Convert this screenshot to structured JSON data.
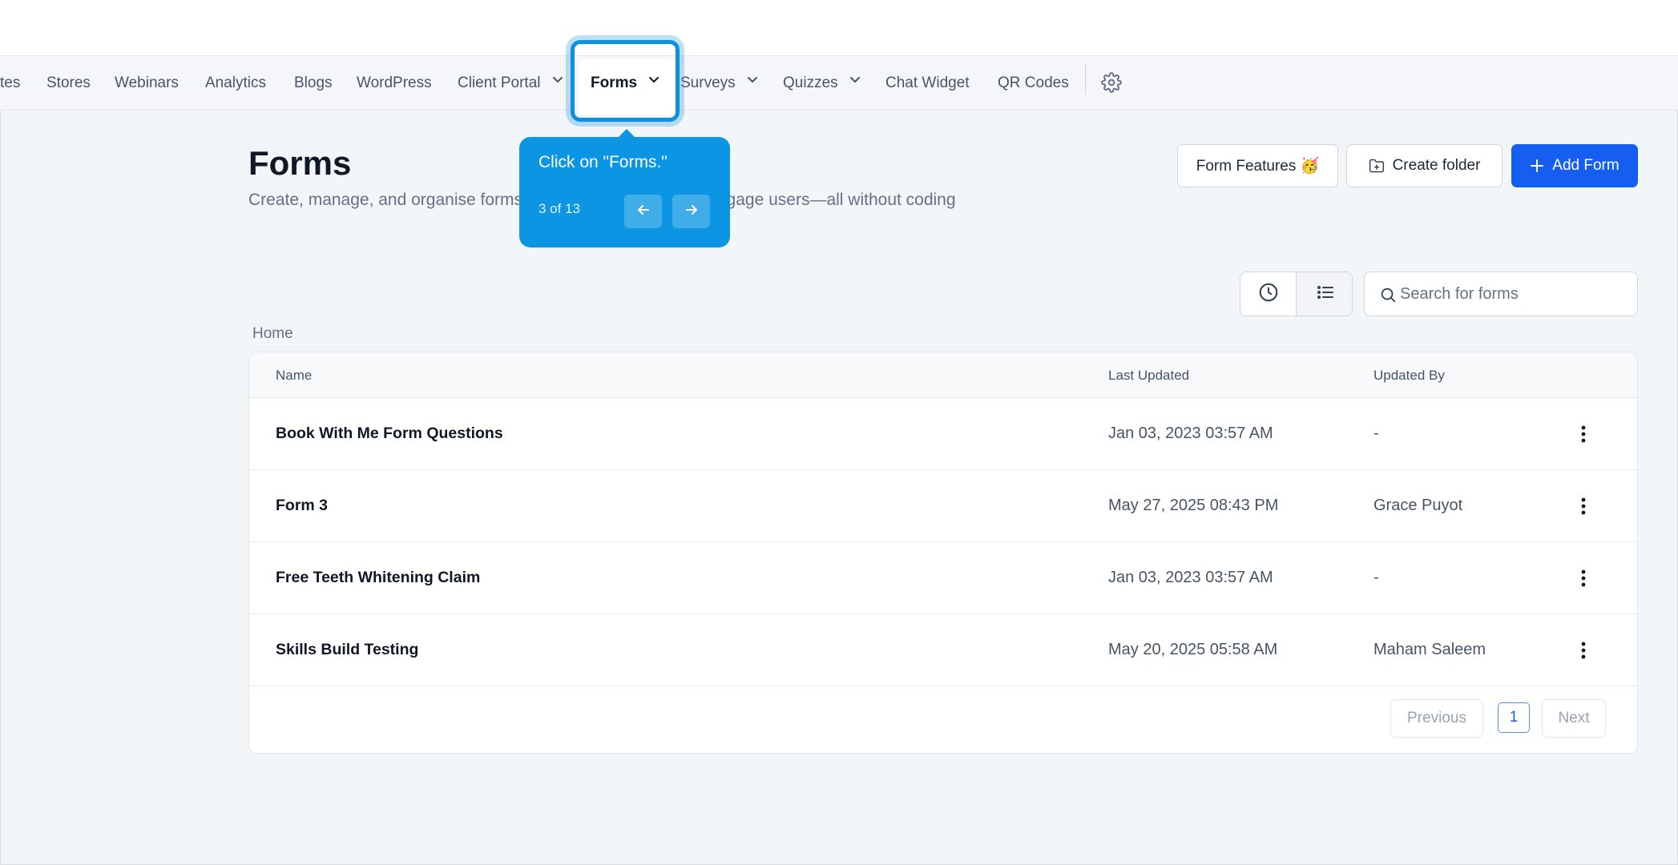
{
  "nav": {
    "items": [
      {
        "label": "tes",
        "dropdown": false
      },
      {
        "label": "Stores",
        "dropdown": false
      },
      {
        "label": "Webinars",
        "dropdown": false
      },
      {
        "label": "Analytics",
        "dropdown": false
      },
      {
        "label": "Blogs",
        "dropdown": false
      },
      {
        "label": "WordPress",
        "dropdown": false
      },
      {
        "label": "Client Portal",
        "dropdown": true
      },
      {
        "label": "Forms",
        "dropdown": true,
        "active": true
      },
      {
        "label": "Surveys",
        "dropdown": true
      },
      {
        "label": "Quizzes",
        "dropdown": true
      },
      {
        "label": "Chat Widget",
        "dropdown": false
      },
      {
        "label": "QR Codes",
        "dropdown": false
      }
    ],
    "settings_icon": "gear-icon"
  },
  "tour": {
    "text": "Click on \"Forms.\"",
    "step": "3 of 13",
    "prev_icon": "arrow-left-icon",
    "next_icon": "arrow-right-icon"
  },
  "header": {
    "title": "Forms",
    "description": "Create, manage, and organise forms to capture lead info and engage users—all without coding",
    "form_features_label": "Form Features 🥳",
    "create_folder_label": "Create folder",
    "add_form_label": "Add Form"
  },
  "view_toggle": {
    "options": [
      "clock-icon",
      "list-icon"
    ],
    "selected": "list-icon"
  },
  "search": {
    "placeholder": "Search for forms",
    "value": ""
  },
  "breadcrumb": "Home",
  "table": {
    "columns": [
      "Name",
      "Last Updated",
      "Updated By"
    ],
    "rows": [
      {
        "name": "Book With Me Form Questions",
        "last_updated": "Jan 03, 2023 03:57 AM",
        "updated_by": "-"
      },
      {
        "name": "Form 3",
        "last_updated": "May 27, 2025 08:43 PM",
        "updated_by": "Grace Puyot"
      },
      {
        "name": "Free Teeth Whitening Claim",
        "last_updated": "Jan 03, 2023 03:57 AM",
        "updated_by": "-"
      },
      {
        "name": "Skills Build Testing",
        "last_updated": "May 20, 2025 05:58 AM",
        "updated_by": "Maham Saleem"
      }
    ]
  },
  "pagination": {
    "previous_label": "Previous",
    "current_page": "1",
    "next_label": "Next"
  },
  "colors": {
    "accent": "#155eef",
    "tour": "#0b95e2",
    "background": "#f3f6f9"
  }
}
